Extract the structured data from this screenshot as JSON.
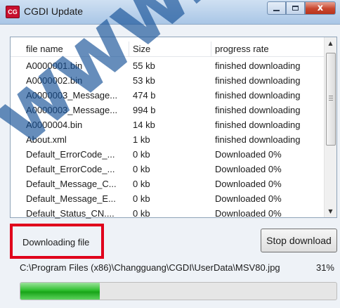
{
  "window": {
    "title": "CGDI Update",
    "icon_text": "CG",
    "controls": {
      "minimize": "",
      "maximize": "",
      "close": "x"
    }
  },
  "list": {
    "columns": [
      "file name",
      "Size",
      "progress rate"
    ],
    "rows": [
      {
        "name": "A0000001.bin",
        "size": "55 kb",
        "progress": "finished downloading"
      },
      {
        "name": "A0000002.bin",
        "size": "53 kb",
        "progress": "finished downloading"
      },
      {
        "name": "A0000003_Message...",
        "size": "474 b",
        "progress": "finished downloading"
      },
      {
        "name": "A0000003_Message...",
        "size": "994 b",
        "progress": "finished downloading"
      },
      {
        "name": "A0000004.bin",
        "size": "14 kb",
        "progress": "finished downloading"
      },
      {
        "name": "About.xml",
        "size": "1 kb",
        "progress": "finished downloading"
      },
      {
        "name": "Default_ErrorCode_...",
        "size": "0 kb",
        "progress": "Downloaded 0%"
      },
      {
        "name": "Default_ErrorCode_...",
        "size": "0 kb",
        "progress": "Downloaded 0%"
      },
      {
        "name": "Default_Message_C...",
        "size": "0 kb",
        "progress": "Downloaded 0%"
      },
      {
        "name": "Default_Message_E...",
        "size": "0 kb",
        "progress": "Downloaded 0%"
      },
      {
        "name": "Default_Status_CN....",
        "size": "0 kb",
        "progress": "Downloaded 0%"
      }
    ]
  },
  "status": {
    "label": "Downloading file"
  },
  "stop_button": {
    "label": "Stop download"
  },
  "current_file": {
    "path": "C:\\Program Files (x86)\\Changguang\\CGDI\\UserData\\MSV80.jpg",
    "percent_text": "31%"
  },
  "progress": {
    "fraction": 0.25,
    "color": "#2fbf2f"
  },
  "colors": {
    "highlight_border": "#e0001b",
    "titlebar": "#bcd3ec",
    "close_button": "#c8462e"
  },
  "watermark": {
    "text": "www.uobd"
  }
}
